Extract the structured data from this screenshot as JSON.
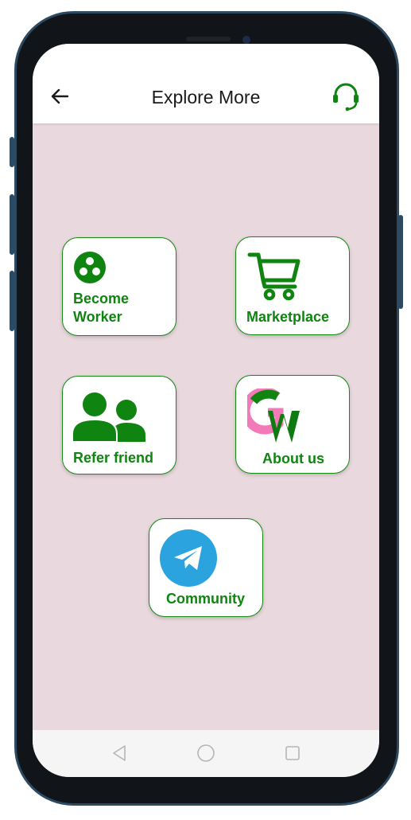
{
  "header": {
    "title": "Explore More",
    "back_icon": "arrow-left-icon",
    "support_icon": "headset-icon"
  },
  "tiles": [
    {
      "label_lines": [
        "Become",
        "Worker"
      ],
      "icon": "group-dots-icon"
    },
    {
      "label": "Marketplace",
      "icon": "shopping-cart-icon"
    },
    {
      "label": "Refer friend",
      "icon": "people-icon"
    },
    {
      "label": "About us",
      "icon": "gw-logo"
    },
    {
      "label": "Community",
      "icon": "telegram-icon"
    }
  ],
  "navigation": {
    "back_icon": "triangle-back-icon",
    "home_icon": "circle-home-icon",
    "recents_icon": "square-recents-icon"
  },
  "colors": {
    "accent_green": "#0f8410",
    "background": "#e9d8dd",
    "telegram_blue": "#2aa3df",
    "logo_pink": "#f27ab8"
  }
}
